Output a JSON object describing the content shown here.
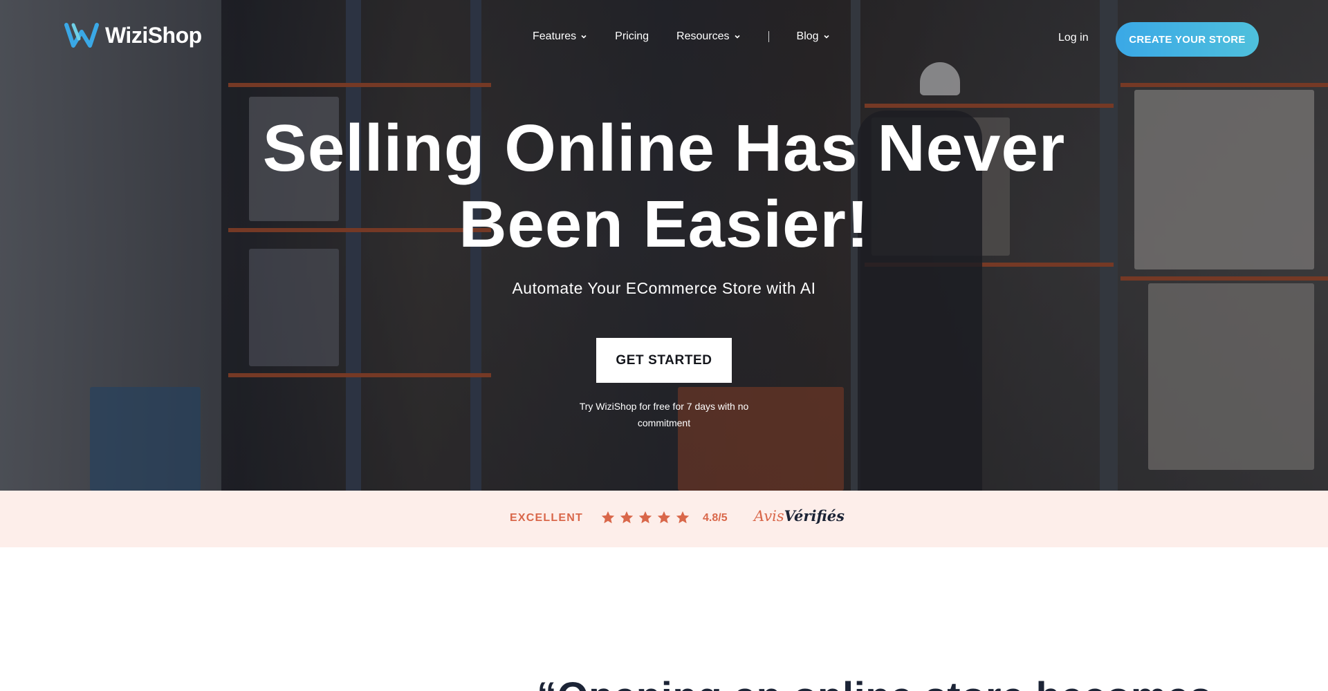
{
  "brand": {
    "name": "WiziShop"
  },
  "nav": {
    "items": [
      {
        "label": "Features",
        "dropdown": true
      },
      {
        "label": "Pricing",
        "dropdown": false
      },
      {
        "label": "Resources",
        "dropdown": true
      },
      {
        "label": "Blog",
        "dropdown": true
      }
    ],
    "login_label": "Log in",
    "cta_label": "CREATE YOUR STORE"
  },
  "hero": {
    "headline_line1": "Selling Online Has Never",
    "headline_line2": "Been Easier!",
    "subheadline": "Automate Your ECommerce Store with AI",
    "button_label": "GET STARTED",
    "trial_note": "Try WiziShop for free for 7 days with no commitment"
  },
  "rating": {
    "label": "EXCELLENT",
    "stars": 5,
    "score": "4.8/5",
    "provider_part1": "Avis",
    "provider_part2": "Vérifiés"
  },
  "quote": {
    "text": "“Opening an online store becomes"
  },
  "colors": {
    "accent_blue": "#3aa8e6",
    "accent_teal": "#4fc0dc",
    "rating_orange": "#d9674a",
    "band_bg": "#fdeeea",
    "dark_text": "#1c2436"
  }
}
